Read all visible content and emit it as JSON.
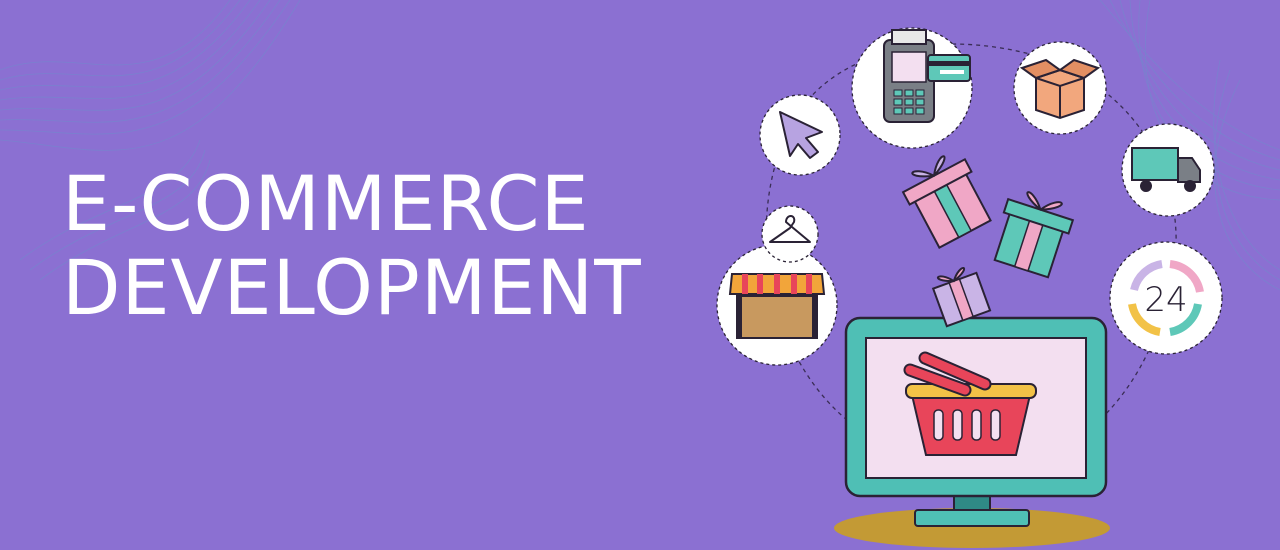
{
  "banner": {
    "title_line_1": "E-COMMERCE",
    "title_line_2": "DEVELOPMENT",
    "clock_label": "24"
  },
  "colors": {
    "background": "#8b70d2",
    "title_text": "#ffffff",
    "monitor_frame": "#4fbfb5",
    "screen": "#f3dff0",
    "basket": "#e8455a",
    "basket_rim": "#f2c247",
    "shadow": "#c39a35",
    "icon_circle": "#ffffff"
  },
  "icons": [
    "cursor-arrow-icon",
    "card-terminal-icon",
    "box-icon",
    "delivery-truck-icon",
    "clock-24-icon",
    "market-stall-icon",
    "hanger-icon",
    "gift-icon",
    "shopping-basket-icon",
    "computer-monitor-icon"
  ]
}
